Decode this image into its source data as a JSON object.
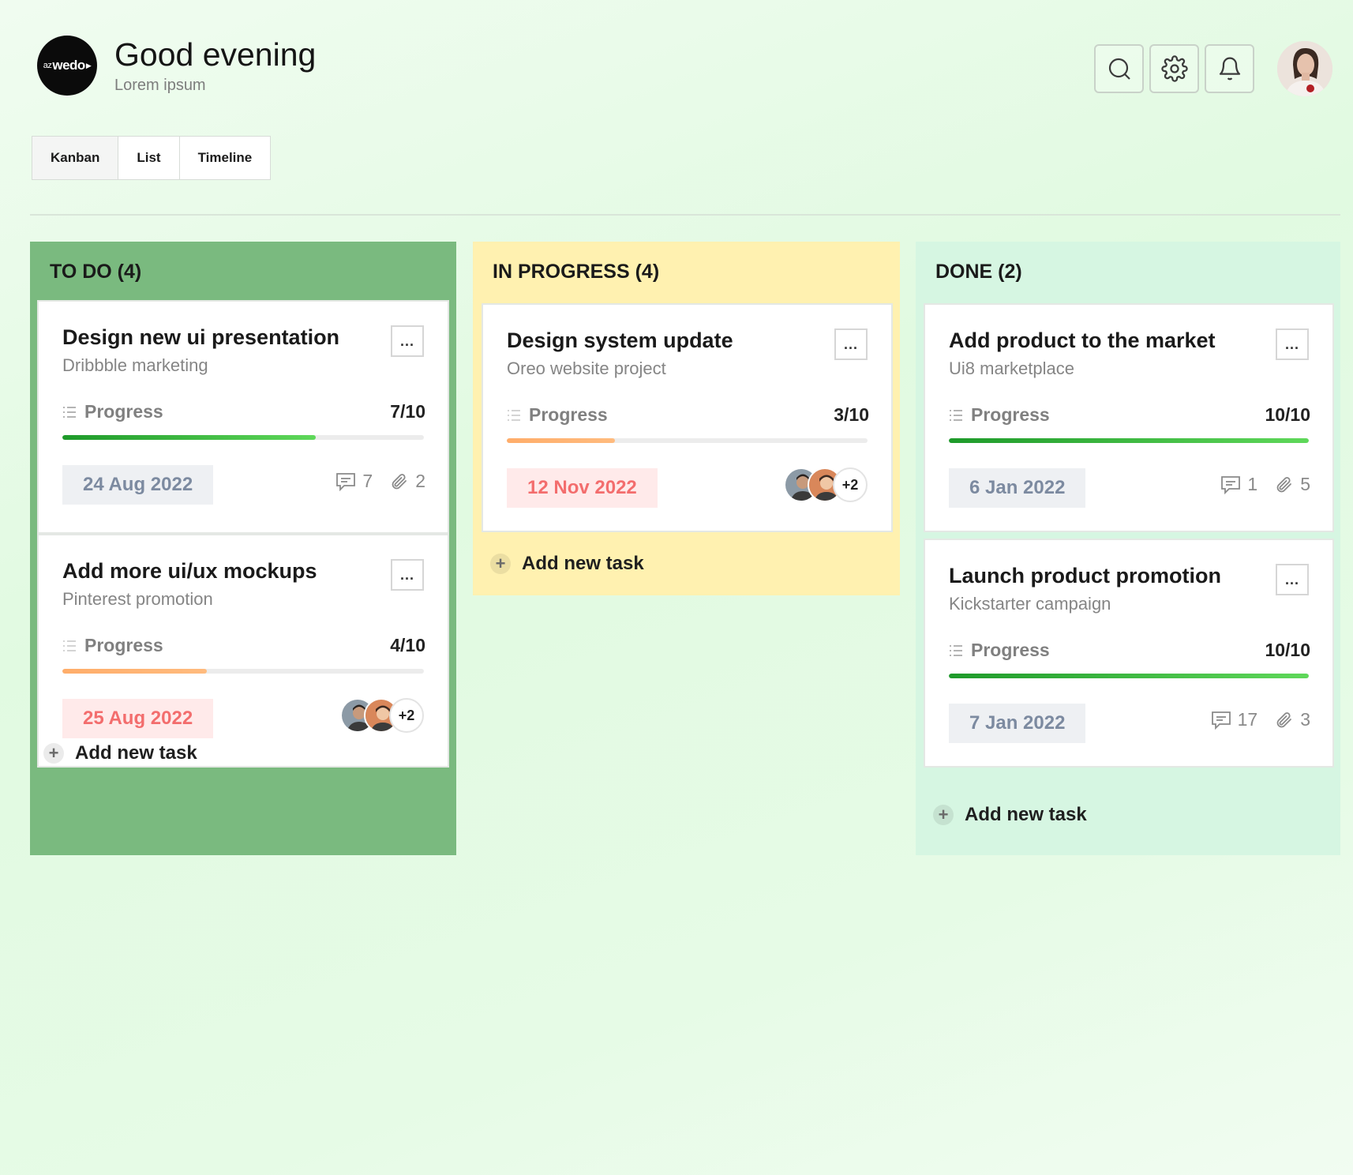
{
  "header": {
    "logo_prefix": "az",
    "logo_text": "wedo",
    "greeting": "Good evening",
    "subtitle": "Lorem ipsum"
  },
  "tabs": [
    {
      "label": "Kanban",
      "active": true
    },
    {
      "label": "List",
      "active": false
    },
    {
      "label": "Timeline",
      "active": false
    }
  ],
  "columns": {
    "todo": {
      "title": "TO DO (4)",
      "color": "#7aba7f",
      "add_label": "Add new task",
      "cards": [
        {
          "title": "Design new ui presentation",
          "subtitle": "Dribbble marketing",
          "progress_label": "Progress",
          "progress_text": "7/10",
          "progress": 0.7,
          "date": "24 Aug 2022",
          "comments": "7",
          "attachments": "2"
        },
        {
          "title": "Add more ui/ux mockups",
          "subtitle": "Pinterest promotion",
          "progress_label": "Progress",
          "progress_text": "4/10",
          "progress": 0.4,
          "date": "25 Aug 2022",
          "extra_members": "+2"
        }
      ]
    },
    "inprogress": {
      "title": "IN PROGRESS (4)",
      "color": "#fff1b0",
      "add_label": "Add new task",
      "cards": [
        {
          "title": "Design system update",
          "subtitle": "Oreo website project",
          "progress_label": "Progress",
          "progress_text": "3/10",
          "progress": 0.3,
          "date": "12 Nov 2022",
          "extra_members": "+2"
        }
      ]
    },
    "done": {
      "title": "DONE (2)",
      "color": "#d6f6e2",
      "add_label": "Add new task",
      "cards": [
        {
          "title": "Add product to the market",
          "subtitle": "Ui8 marketplace",
          "progress_label": "Progress",
          "progress_text": "10/10",
          "progress": 1.0,
          "date": "6 Jan 2022",
          "comments": "1",
          "attachments": "5"
        },
        {
          "title": "Launch product promotion",
          "subtitle": "Kickstarter campaign",
          "progress_label": "Progress",
          "progress_text": "10/10",
          "progress": 1.0,
          "date": "7 Jan 2022",
          "comments": "17",
          "attachments": "3"
        }
      ]
    }
  },
  "more_label": "..."
}
